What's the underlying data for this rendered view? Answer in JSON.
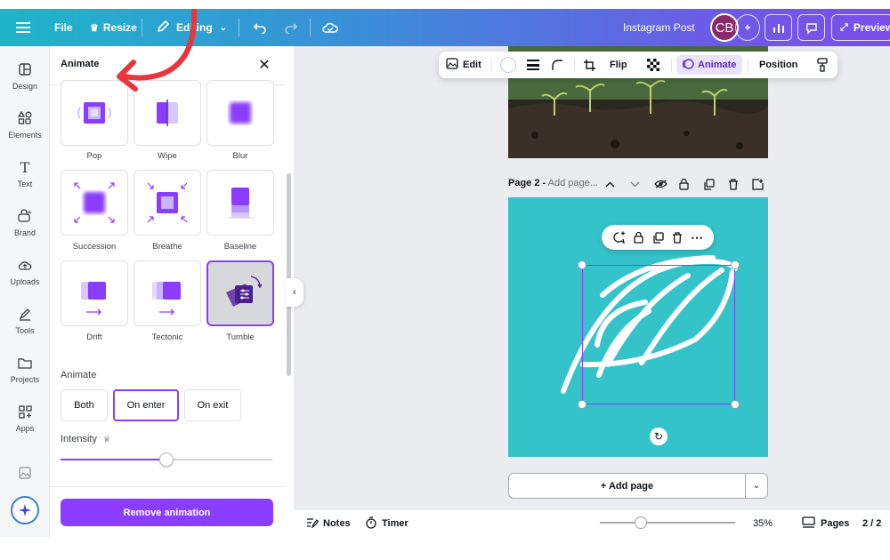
{
  "topbar": {
    "file": "File",
    "resize": "Resize",
    "editing": "Editing",
    "doc_title": "Instagram Post",
    "avatar_initials": "CB",
    "preview": "Preview"
  },
  "rail": [
    {
      "label": "Design",
      "icon": "design-icon"
    },
    {
      "label": "Elements",
      "icon": "elements-icon"
    },
    {
      "label": "Text",
      "icon": "text-icon"
    },
    {
      "label": "Brand",
      "icon": "brand-icon"
    },
    {
      "label": "Uploads",
      "icon": "uploads-icon"
    },
    {
      "label": "Tools",
      "icon": "tools-icon"
    },
    {
      "label": "Projects",
      "icon": "projects-icon"
    },
    {
      "label": "Apps",
      "icon": "apps-icon"
    }
  ],
  "panel": {
    "title": "Animate",
    "animations": [
      {
        "label": "Pop"
      },
      {
        "label": "Wipe"
      },
      {
        "label": "Blur"
      },
      {
        "label": "Succession"
      },
      {
        "label": "Breathe"
      },
      {
        "label": "Baseline"
      },
      {
        "label": "Drift"
      },
      {
        "label": "Tectonic"
      },
      {
        "label": "Tumble",
        "selected": true
      }
    ],
    "animate_label": "Animate",
    "modes": [
      "Both",
      "On enter",
      "On exit"
    ],
    "active_mode": "On enter",
    "intensity_label": "Intensity",
    "intensity_value": 0.5,
    "remove_button": "Remove animation"
  },
  "toolbar": {
    "edit": "Edit",
    "flip": "Flip",
    "animate": "Animate",
    "position": "Position"
  },
  "canvas": {
    "page_label": "Page 2 -",
    "page_placeholder": "Add page...",
    "add_page": "+ Add page",
    "page2_bg": "#34c3c9"
  },
  "bottombar": {
    "notes": "Notes",
    "timer": "Timer",
    "zoom": "35%",
    "pages": "Pages",
    "page_count": "2 / 2",
    "zoom_value": 0.3
  },
  "colors": {
    "accent": "#8b3dff",
    "annotation_arrow": "#e8363c"
  }
}
